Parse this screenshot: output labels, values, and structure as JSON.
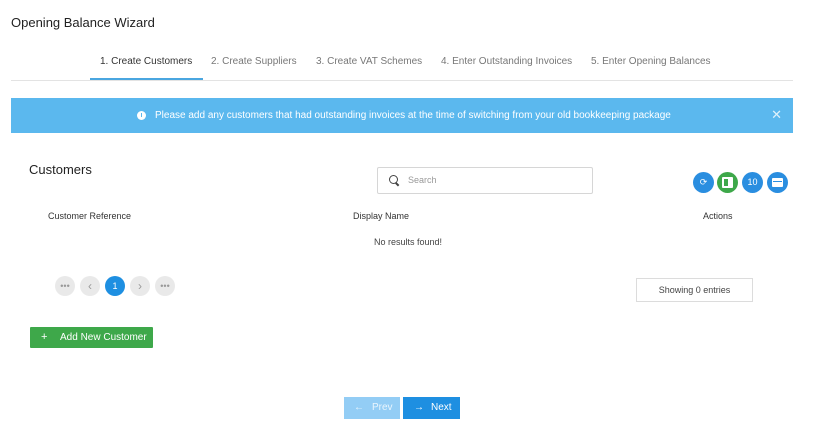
{
  "page": {
    "title": "Opening Balance Wizard"
  },
  "tabs": [
    {
      "label": "1. Create Customers",
      "active": true
    },
    {
      "label": "2. Create Suppliers",
      "active": false
    },
    {
      "label": "3. Create VAT Schemes",
      "active": false
    },
    {
      "label": "4. Enter Outstanding Invoices",
      "active": false
    },
    {
      "label": "5. Enter Opening Balances",
      "active": false
    }
  ],
  "banner": {
    "message": "Please add any customers that had outstanding invoices at the time of switching from your old bookkeeping package",
    "close_glyph": "✕",
    "color": "#5bb8ee"
  },
  "customers": {
    "title": "Customers",
    "search": {
      "placeholder": "Search",
      "value": ""
    },
    "toolbar": {
      "refresh_glyph": "⟳",
      "page_size": "10"
    },
    "table": {
      "columns": [
        "Customer Reference",
        "Display Name",
        "Actions"
      ],
      "rows": [],
      "empty_message": "No results found!"
    },
    "pagination": {
      "first_glyph": "•••",
      "prev_glyph": "‹",
      "current_page": "1",
      "next_glyph": "›",
      "last_glyph": "•••"
    },
    "showing": "Showing 0 entries",
    "add_button": {
      "plus": "+",
      "label": "Add New Customer"
    }
  },
  "wizard_nav": {
    "prev": {
      "arrow": "←",
      "label": "Prev"
    },
    "next": {
      "arrow": "→",
      "label": "Next"
    }
  },
  "colors": {
    "primary": "#1e8fe1",
    "success": "#3ea84a",
    "info": "#5bb8ee"
  },
  "icons": [
    "info-icon",
    "close-icon",
    "search-icon",
    "refresh-icon",
    "excel-icon",
    "columns-icon",
    "plus-icon",
    "arrow-left-icon",
    "arrow-right-icon"
  ]
}
